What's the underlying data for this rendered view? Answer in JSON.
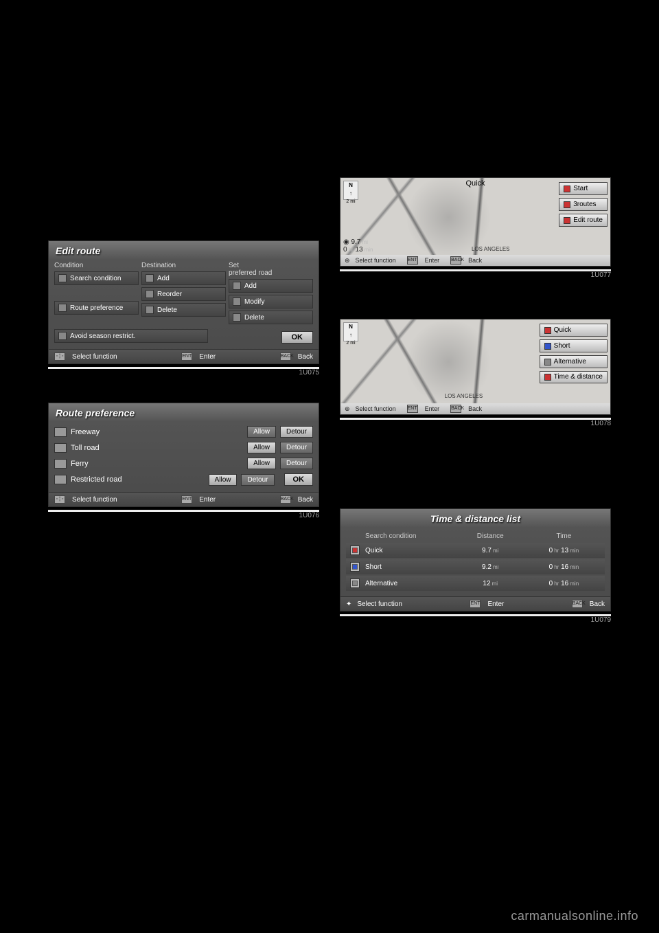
{
  "captions": {
    "c1": "1U075",
    "c2": "1U076",
    "c3": "1U077",
    "c4": "1U078",
    "c5": "1U079"
  },
  "footer": {
    "select": "Select function",
    "enter": "Enter",
    "back": "Back"
  },
  "editRoute": {
    "title": "Edit route",
    "conditionHead": "Condition",
    "destinationHead": "Destination",
    "preferredHead": "Set\npreferred road",
    "searchCondition": "Search condition",
    "routePreference": "Route preference",
    "add": "Add",
    "reorder": "Reorder",
    "delete": "Delete",
    "modify": "Modify",
    "avoid": "Avoid season restrict.",
    "ok": "OK"
  },
  "routePref": {
    "title": "Route preference",
    "rows": [
      {
        "label": "Freeway",
        "allow": "Allow",
        "detour": "Detour",
        "sel": "allow"
      },
      {
        "label": "Toll road",
        "allow": "Allow",
        "detour": "Detour",
        "sel": "detour"
      },
      {
        "label": "Ferry",
        "allow": "Allow",
        "detour": "Detour",
        "sel": "detour"
      },
      {
        "label": "Restricted road",
        "allow": "Allow",
        "detour": "Detour",
        "sel": "detour"
      }
    ],
    "ok": "OK"
  },
  "map1": {
    "compassN": "N",
    "compassScale": "2 mi",
    "title": "Quick",
    "btn1": "Start",
    "btn2": "3routes",
    "btn3": "Edit route",
    "distMi": "9.7",
    "distMiUnit": "mi",
    "timeHr": "0",
    "timeHrUnit": "hr",
    "timeMin": "13",
    "timeMinUnit": "min",
    "place": "LOS ANGELES"
  },
  "map2": {
    "compassN": "N",
    "compassScale": "2 mi",
    "btn1": "Quick",
    "btn2": "Short",
    "btn3": "Alternative",
    "btn4": "Time & distance",
    "place": "LOS ANGELES"
  },
  "tdlist": {
    "title": "Time & distance list",
    "h1": "Search condition",
    "h2": "Distance",
    "h3": "Time",
    "rows": [
      {
        "name": "Quick",
        "dist": "9.7",
        "distUnit": "mi",
        "hr": "0",
        "min": "13"
      },
      {
        "name": "Short",
        "dist": "9.2",
        "distUnit": "mi",
        "hr": "0",
        "min": "16"
      },
      {
        "name": "Alternative",
        "dist": "12",
        "distUnit": "mi",
        "hr": "0",
        "min": "16"
      }
    ],
    "hrUnit": "hr",
    "minUnit": "min"
  },
  "watermark": "carmanualsonline.info"
}
